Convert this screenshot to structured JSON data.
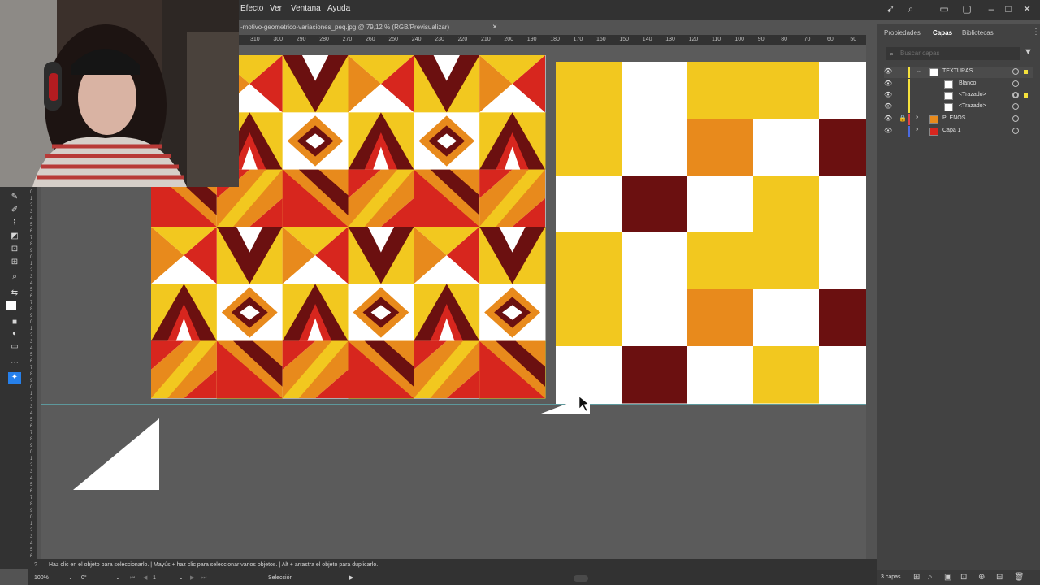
{
  "menubar": {
    "items": [
      "Efecto",
      "Ver",
      "Ventana",
      "Ayuda"
    ]
  },
  "document": {
    "tab_title": "-motivo-geometrico-variaciones_peq.jpg @ 79,12 % (RGB/Previsualizar)",
    "close_symbol": "×"
  },
  "ruler": {
    "top_labels": [
      "310",
      "300",
      "290",
      "280",
      "270",
      "260",
      "250",
      "240",
      "230",
      "220",
      "210",
      "200",
      "190",
      "180",
      "170",
      "160",
      "150",
      "140",
      "130",
      "120",
      "110",
      "100",
      "90",
      "80",
      "70",
      "60",
      "50"
    ]
  },
  "panel": {
    "tabs": [
      "Propiedades",
      "Capas",
      "Bibliotecas"
    ],
    "active_tab": "Capas",
    "search_placeholder": "Buscar capas",
    "layers": [
      {
        "name": "TEXTURAS",
        "color": "#f5e13b"
      },
      {
        "name": "Blanco",
        "color": "#f5e13b"
      },
      {
        "name": "<Trazado>",
        "color": "#f5e13b"
      },
      {
        "name": "<Trazado>",
        "color": "#f5e13b"
      },
      {
        "name": "PLENOS",
        "color": "#e0424b"
      },
      {
        "name": "Capa 1",
        "color": "#4b6be0"
      }
    ],
    "footer_count": "3 capas"
  },
  "status": {
    "hint": "Haz clic en el objeto para seleccionarlo. | Mayús + haz clic para seleccionar varios objetos. | Alt + arrastra el objeto para duplicarlo.",
    "zoom": "100%",
    "rotation": "0°",
    "artboard": "1",
    "tool": "Selección"
  },
  "colors": {
    "yellow": "#f2c81f",
    "orange": "#e88a1c",
    "red": "#d7261e",
    "maroon": "#6b1010",
    "white": "#ffffff"
  }
}
